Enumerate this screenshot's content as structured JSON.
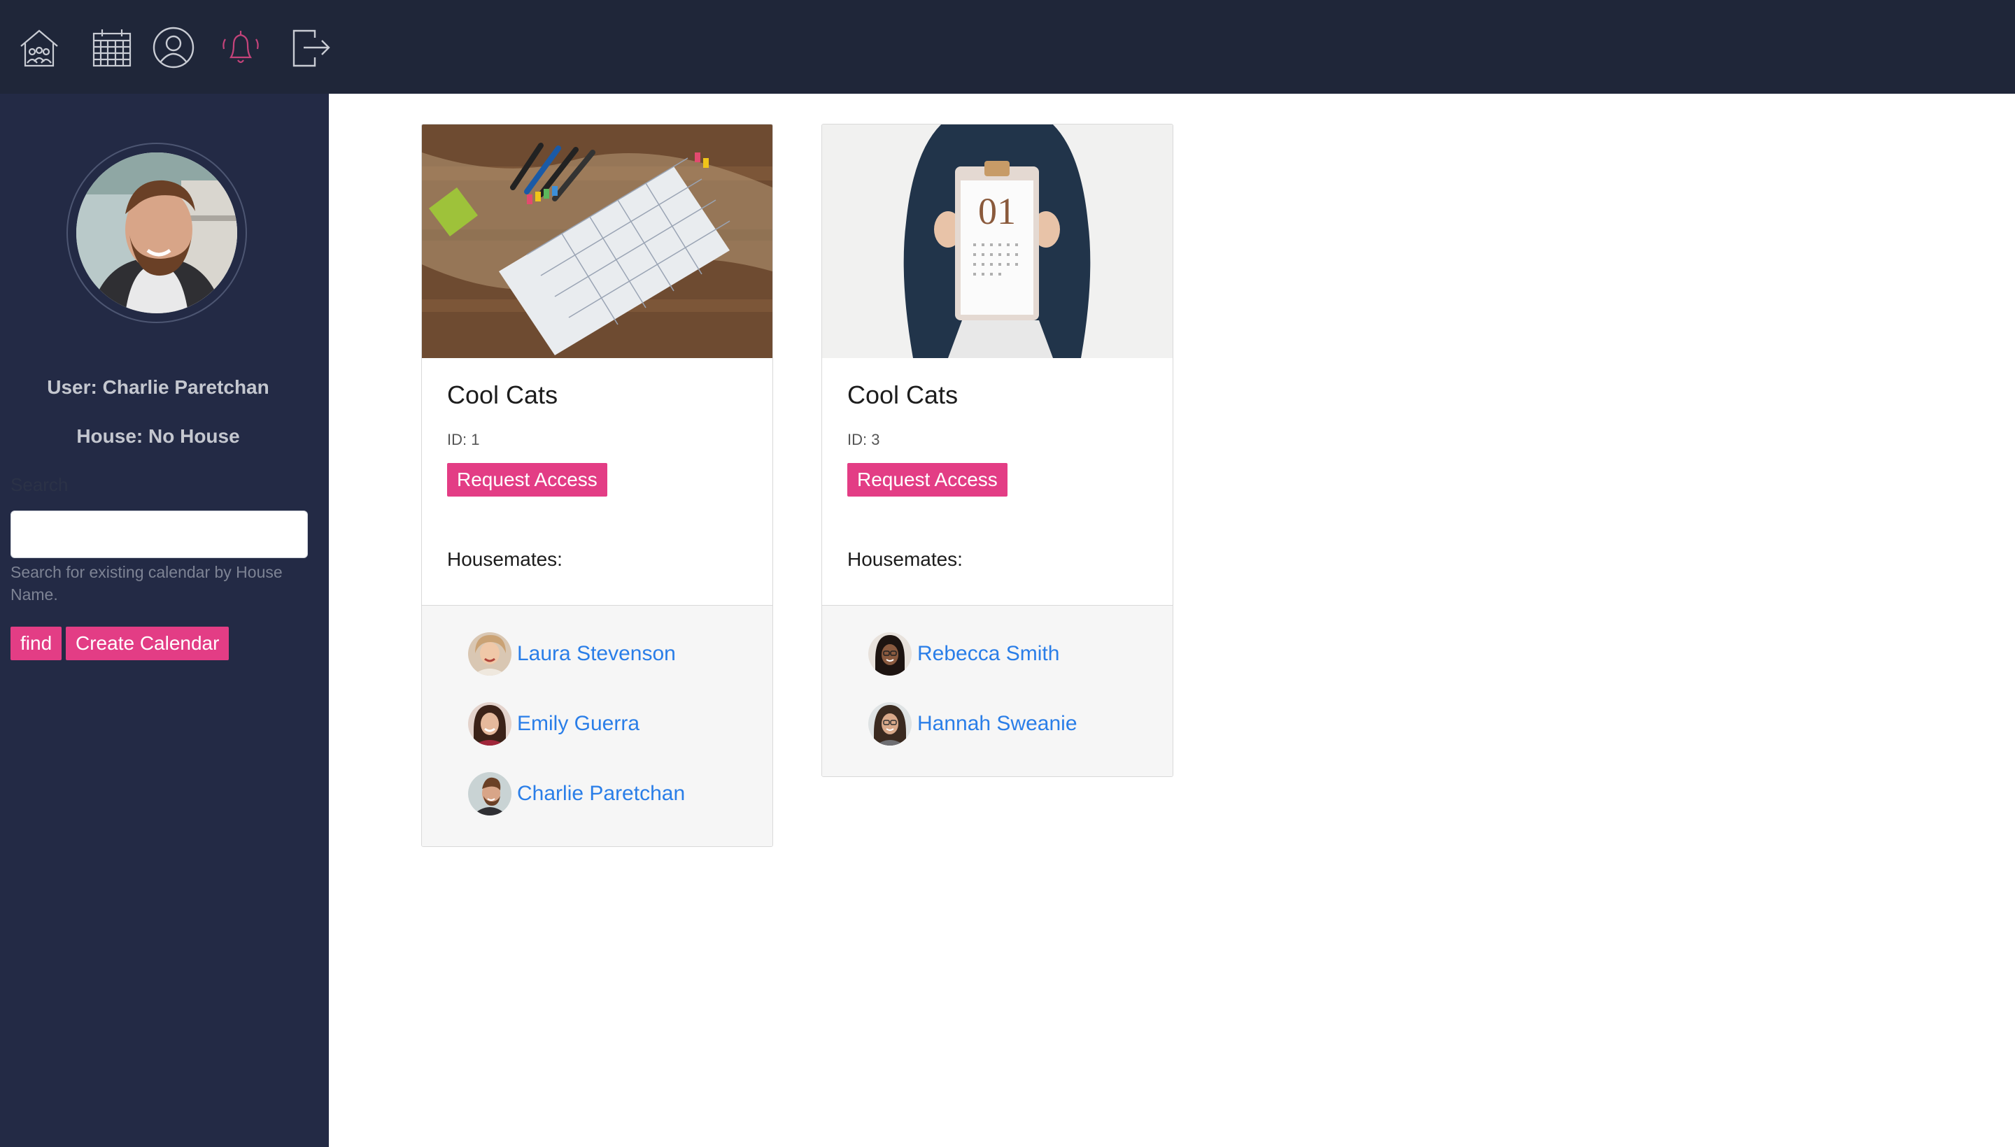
{
  "nav": {
    "icons": [
      "house-icon",
      "calendar-icon",
      "user-icon",
      "bell-icon",
      "logout-icon"
    ],
    "accent_bell": "#c4437a"
  },
  "sidebar": {
    "user_text": "User: Charlie Paretchan",
    "house_text": "House: No House",
    "search_label": "Search",
    "search_value": "",
    "search_help": "Search for existing calendar by House Name.",
    "find_label": "find",
    "create_label": "Create Calendar"
  },
  "cards": [
    {
      "title": "Cool Cats",
      "id_text": "ID: 1",
      "button_label": "Request Access",
      "housemates_label": "Housemates:",
      "housemates": [
        "Laura Stevenson",
        "Emily Guerra",
        "Charlie Paretchan"
      ]
    },
    {
      "title": "Cool Cats",
      "id_text": "ID: 3",
      "button_label": "Request Access",
      "housemates_label": "Housemates:",
      "housemates": [
        "Rebecca Smith",
        "Hannah Sweanie"
      ]
    }
  ],
  "colors": {
    "topbar": "#1f2639",
    "sidebar": "#232a45",
    "accent": "#e33d85",
    "link": "#2a7ee8"
  }
}
